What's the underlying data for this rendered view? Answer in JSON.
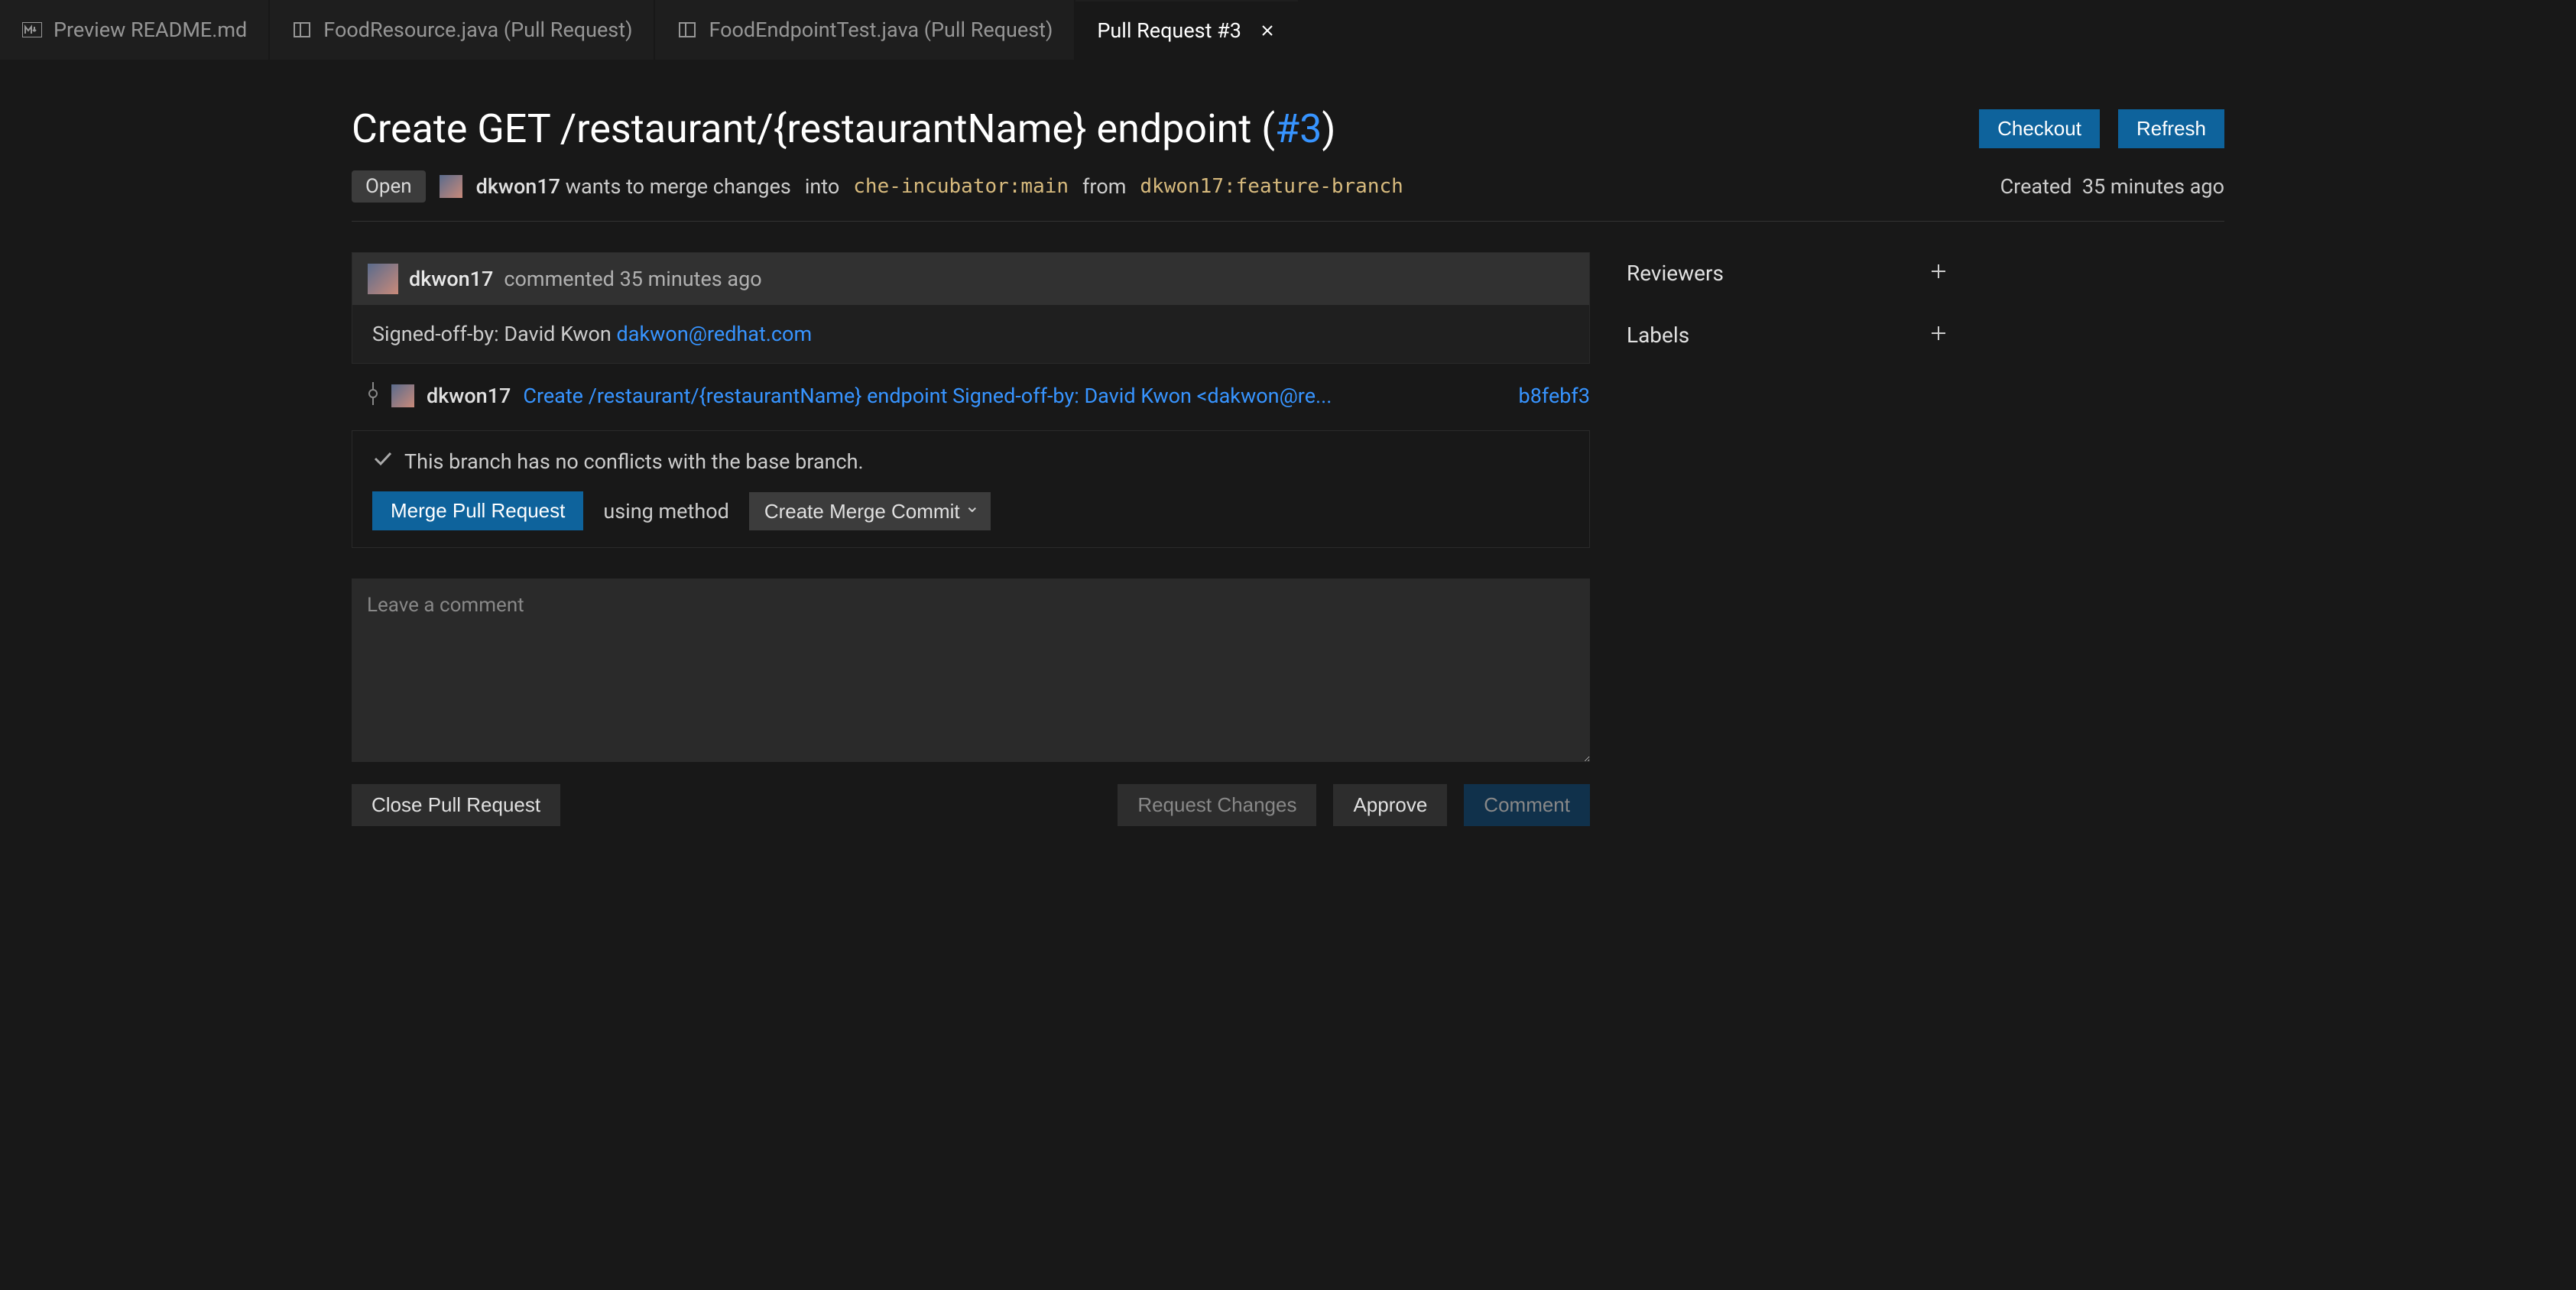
{
  "tabs": [
    {
      "label": "Preview README.md"
    },
    {
      "label": "FoodResource.java (Pull Request)"
    },
    {
      "label": "FoodEndpointTest.java (Pull Request)"
    },
    {
      "label": "Pull Request #3"
    }
  ],
  "pr": {
    "title_prefix": "Create GET /restaurant/{restaurantName} endpoint (",
    "number": "#3",
    "title_suffix": ")",
    "checkout_label": "Checkout",
    "refresh_label": "Refresh",
    "state": "Open",
    "author": "dkwon17",
    "merge_prefix": "wants to merge changes",
    "into_label": "into",
    "target_branch": "che-incubator:main",
    "from_label": "from",
    "source_branch": "dkwon17:feature-branch",
    "created_label": "Created",
    "created_when": "35 minutes ago"
  },
  "comment": {
    "user": "dkwon17",
    "when": "commented 35 minutes ago",
    "body_prefix": "Signed-off-by: David Kwon ",
    "body_link": "dakwon@redhat.com"
  },
  "commit": {
    "user": "dkwon17",
    "message": "Create /restaurant/{restaurantName} endpoint Signed-off-by: David Kwon <dakwon@re...",
    "sha": "b8febf3"
  },
  "merge": {
    "no_conflicts": "This branch has no conflicts with the base branch.",
    "merge_btn": "Merge Pull Request",
    "method_label": "using method",
    "method_selected": "Create Merge Commit"
  },
  "input": {
    "placeholder": "Leave a comment"
  },
  "buttons": {
    "close_pr": "Close Pull Request",
    "request_changes": "Request Changes",
    "approve": "Approve",
    "comment": "Comment"
  },
  "side": {
    "reviewers": "Reviewers",
    "labels": "Labels"
  }
}
